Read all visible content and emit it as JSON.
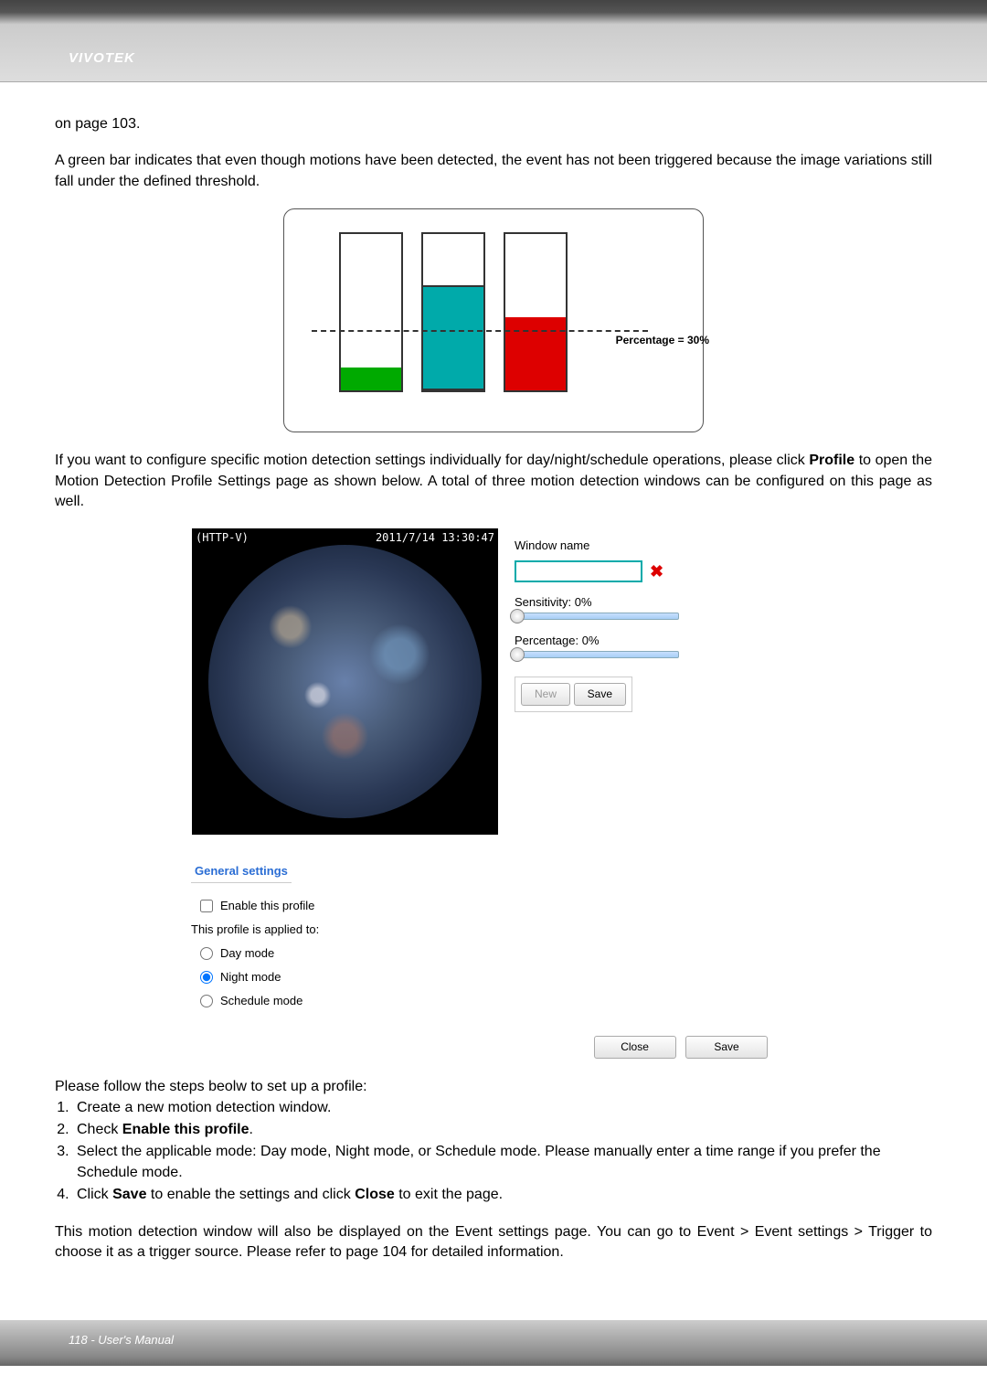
{
  "header": {
    "brand": "VIVOTEK"
  },
  "body": {
    "p1": "on page 103.",
    "p2": "A green bar indicates that even though motions have been detected, the event has not been triggered because the image variations still fall under the defined threshold.",
    "pct_label": "Percentage = 30%",
    "p3_prefix": "If you want to configure specific motion detection settings individually for day/night/schedule operations, please click ",
    "p3_bold": "Profile",
    "p3_suffix": " to open the Motion Detection Profile Settings page as shown below. A total of three motion detection windows can be configured on this page as well.",
    "cam": {
      "protocol": "(HTTP-V)",
      "timestamp": "2011/7/14 13:30:47"
    },
    "sidepanel": {
      "window_name_label": "Window name",
      "window_name_value": "",
      "sensitivity_label": "Sensitivity: 0%",
      "percentage_label": "Percentage: 0%",
      "new_btn": "New",
      "save_btn": "Save"
    },
    "general": {
      "title": "General settings",
      "enable": "Enable this profile",
      "applied": "This profile is applied to:",
      "day": "Day mode",
      "night": "Night mode",
      "schedule": "Schedule mode",
      "close_btn": "Close",
      "save_btn": "Save"
    },
    "steps_intro": "Please follow the steps beolw to set up a profile:",
    "steps": {
      "s1": "Create a new motion detection window.",
      "s2a": "Check ",
      "s2b": "Enable this profile",
      "s2c": ".",
      "s3": "Select the applicable mode: Day mode, Night mode, or Schedule mode. Please manually enter a time range if you prefer the Schedule mode.",
      "s4a": "Click ",
      "s4b": "Save",
      "s4c": " to enable the settings and click ",
      "s4d": "Close",
      "s4e": " to exit the page."
    },
    "p4": "This motion detection window will also be displayed on the Event settings page. You can go to Event > Event settings > Trigger to choose it as a trigger source. Please refer to page 104 for detailed information."
  },
  "footer": {
    "text": "118 - User's Manual"
  },
  "chart_data": {
    "type": "bar",
    "categories": [
      "bar1",
      "bar2",
      "bar3"
    ],
    "series": [
      {
        "name": "fill_height_pct_of_box",
        "values": [
          14,
          66,
          46
        ]
      },
      {
        "name": "fill_color",
        "values": [
          "green",
          "teal",
          "red"
        ]
      }
    ],
    "threshold_line_pct": 30,
    "threshold_label": "Percentage = 30%"
  }
}
